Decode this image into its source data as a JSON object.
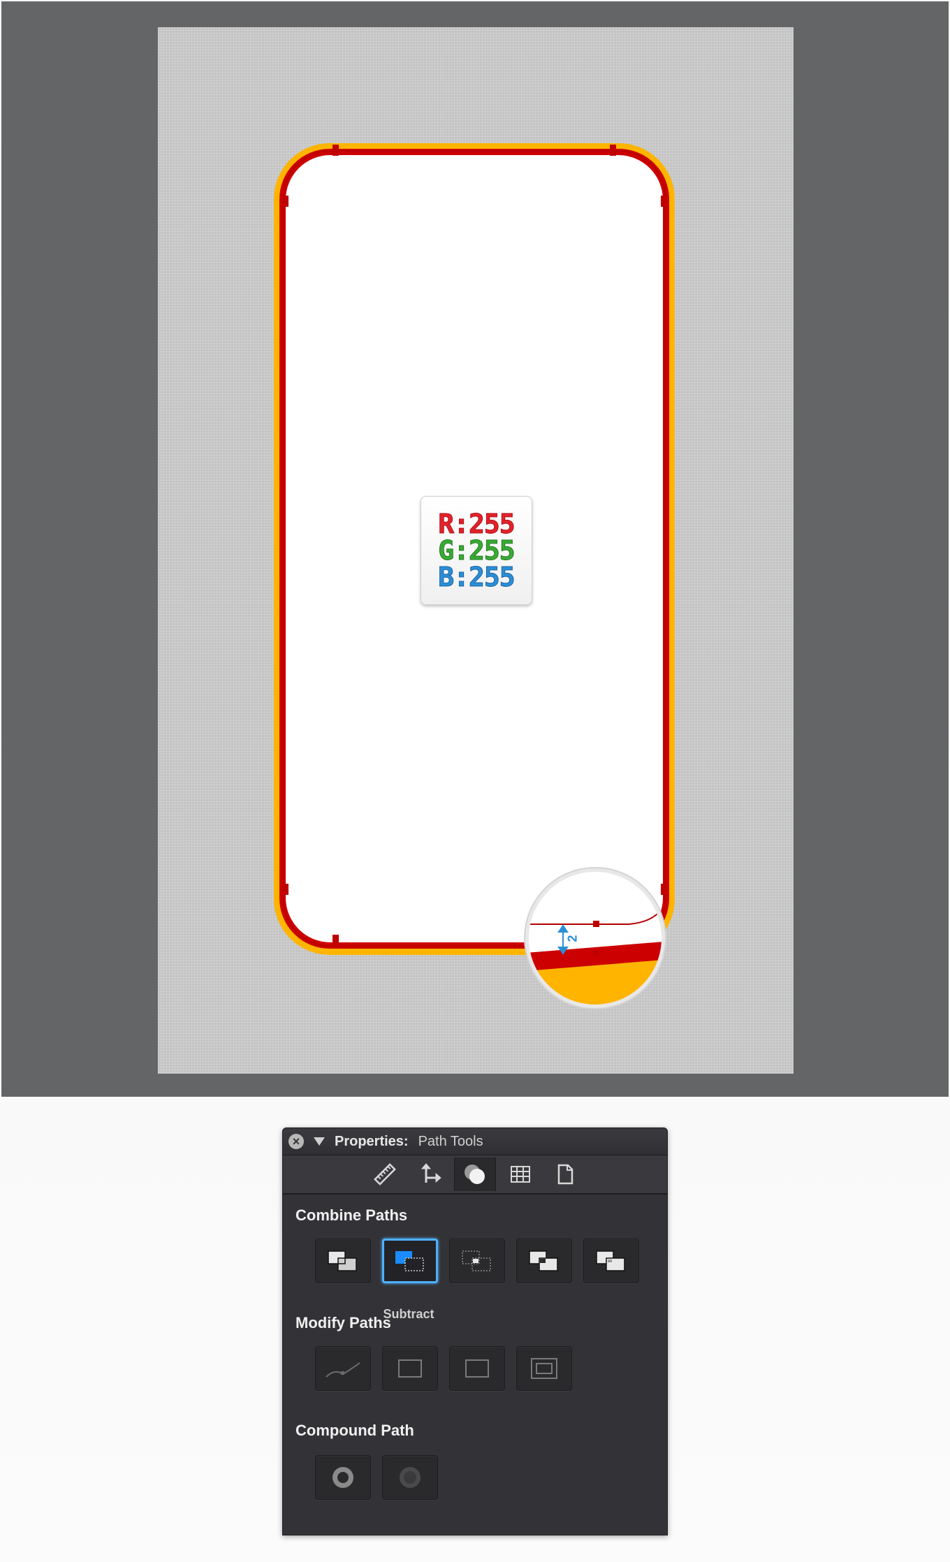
{
  "canvas": {
    "colors": {
      "workspace": "#646567",
      "artboard": "#c3c3c3",
      "outer_shape": "#ffb400",
      "stroke_shape": "#cc0000",
      "fill_shape": "#ffffff",
      "guide": "#b30000"
    },
    "rgb_chip": {
      "r": "R:255",
      "g": "G:255",
      "b": "B:255"
    },
    "zoom_callout": {
      "offset_label": "2",
      "arrow_icon": "double-arrow-icon"
    }
  },
  "panel": {
    "title": "Properties:",
    "subtitle": "Path Tools",
    "close_icon": "close-icon",
    "collapse_icon": "triangle-down-icon",
    "toolbar": {
      "tools": [
        "ruler-icon",
        "transform-icon",
        "path-tools-icon",
        "grid-icon",
        "document-icon"
      ],
      "active_tool": "path-tools-icon"
    },
    "combine_paths": {
      "heading": "Combine Paths",
      "buttons": [
        "unite-icon",
        "subtract-icon",
        "intersect-icon",
        "exclude-icon",
        "divide-icon"
      ],
      "selected_label": "Subtract"
    },
    "modify_paths": {
      "heading": "Modify Paths",
      "buttons": [
        "smooth-path-icon",
        "rectangle-path-icon",
        "rectangle-outline-icon",
        "inset-rectangle-icon"
      ]
    },
    "compound_path": {
      "heading": "Compound Path",
      "buttons": [
        "make-compound-icon",
        "release-compound-icon"
      ]
    }
  }
}
